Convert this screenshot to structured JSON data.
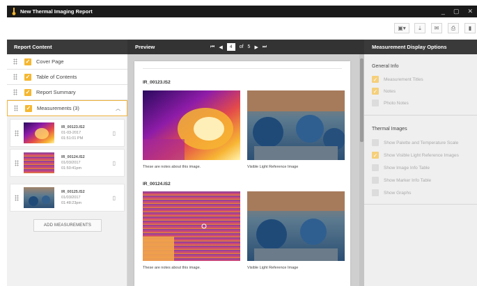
{
  "window": {
    "title": "New Thermal Imaging Report",
    "logo_icon": "thermometer-logo-icon",
    "controls": [
      "_",
      "▢",
      "✕"
    ]
  },
  "toolbar": {
    "buttons": [
      {
        "icon": "save-icon",
        "glyph": "💾▾"
      },
      {
        "icon": "download-icon",
        "glyph": "⭳"
      },
      {
        "icon": "email-icon",
        "glyph": "✉"
      },
      {
        "icon": "print-icon",
        "glyph": "⎙"
      },
      {
        "icon": "delete-icon",
        "glyph": "🗑"
      }
    ]
  },
  "left": {
    "header": "Report Content",
    "items": [
      {
        "label": "Cover Page"
      },
      {
        "label": "Table of Contents"
      },
      {
        "label": "Report Summary"
      },
      {
        "label": "Measurements (3)"
      }
    ],
    "measurements": [
      {
        "name": "IR_00123.IS2",
        "date": "01-03-2017",
        "time": "01:51:01 PM"
      },
      {
        "name": "IR_00124.IS2",
        "date": "01/03/2017",
        "time": "01:50:41pm"
      },
      {
        "name": "IR_00125.IS2",
        "date": "01/03/2017",
        "time": "01:48:23pm"
      }
    ],
    "add_button": "ADD MEASUREMENTS"
  },
  "preview": {
    "header": "Preview",
    "pager": {
      "current": "4",
      "of_label": "of",
      "total": "5"
    },
    "entries": [
      {
        "name": "IR_00123.IS2",
        "notes": "These are notes about this image.",
        "ref_caption": "Visible Light Reference Image"
      },
      {
        "name": "IR_00124.IS2",
        "notes": "These are notes about this image.",
        "ref_caption": "Visible Light Reference Image"
      }
    ]
  },
  "right": {
    "header": "Measurement Display Options",
    "general": {
      "title": "General Info",
      "options": [
        {
          "label": "Measurement Titles",
          "checked": true
        },
        {
          "label": "Notes",
          "checked": true
        },
        {
          "label": "Photo Notes",
          "checked": false
        }
      ]
    },
    "thermal": {
      "title": "Thermal Images",
      "options": [
        {
          "label": "Show Palette and Temperature Scale",
          "checked": false
        },
        {
          "label": "Show Visible Light Reference Images",
          "checked": true
        },
        {
          "label": "Show Image Info Table",
          "checked": false
        },
        {
          "label": "Show Marker Info Table",
          "checked": false
        },
        {
          "label": "Show Graphs",
          "checked": false
        }
      ]
    }
  },
  "colors": {
    "accent": "#f5b731",
    "header_bg": "#3a3a3a",
    "titlebar_bg": "#1a1a1a"
  }
}
